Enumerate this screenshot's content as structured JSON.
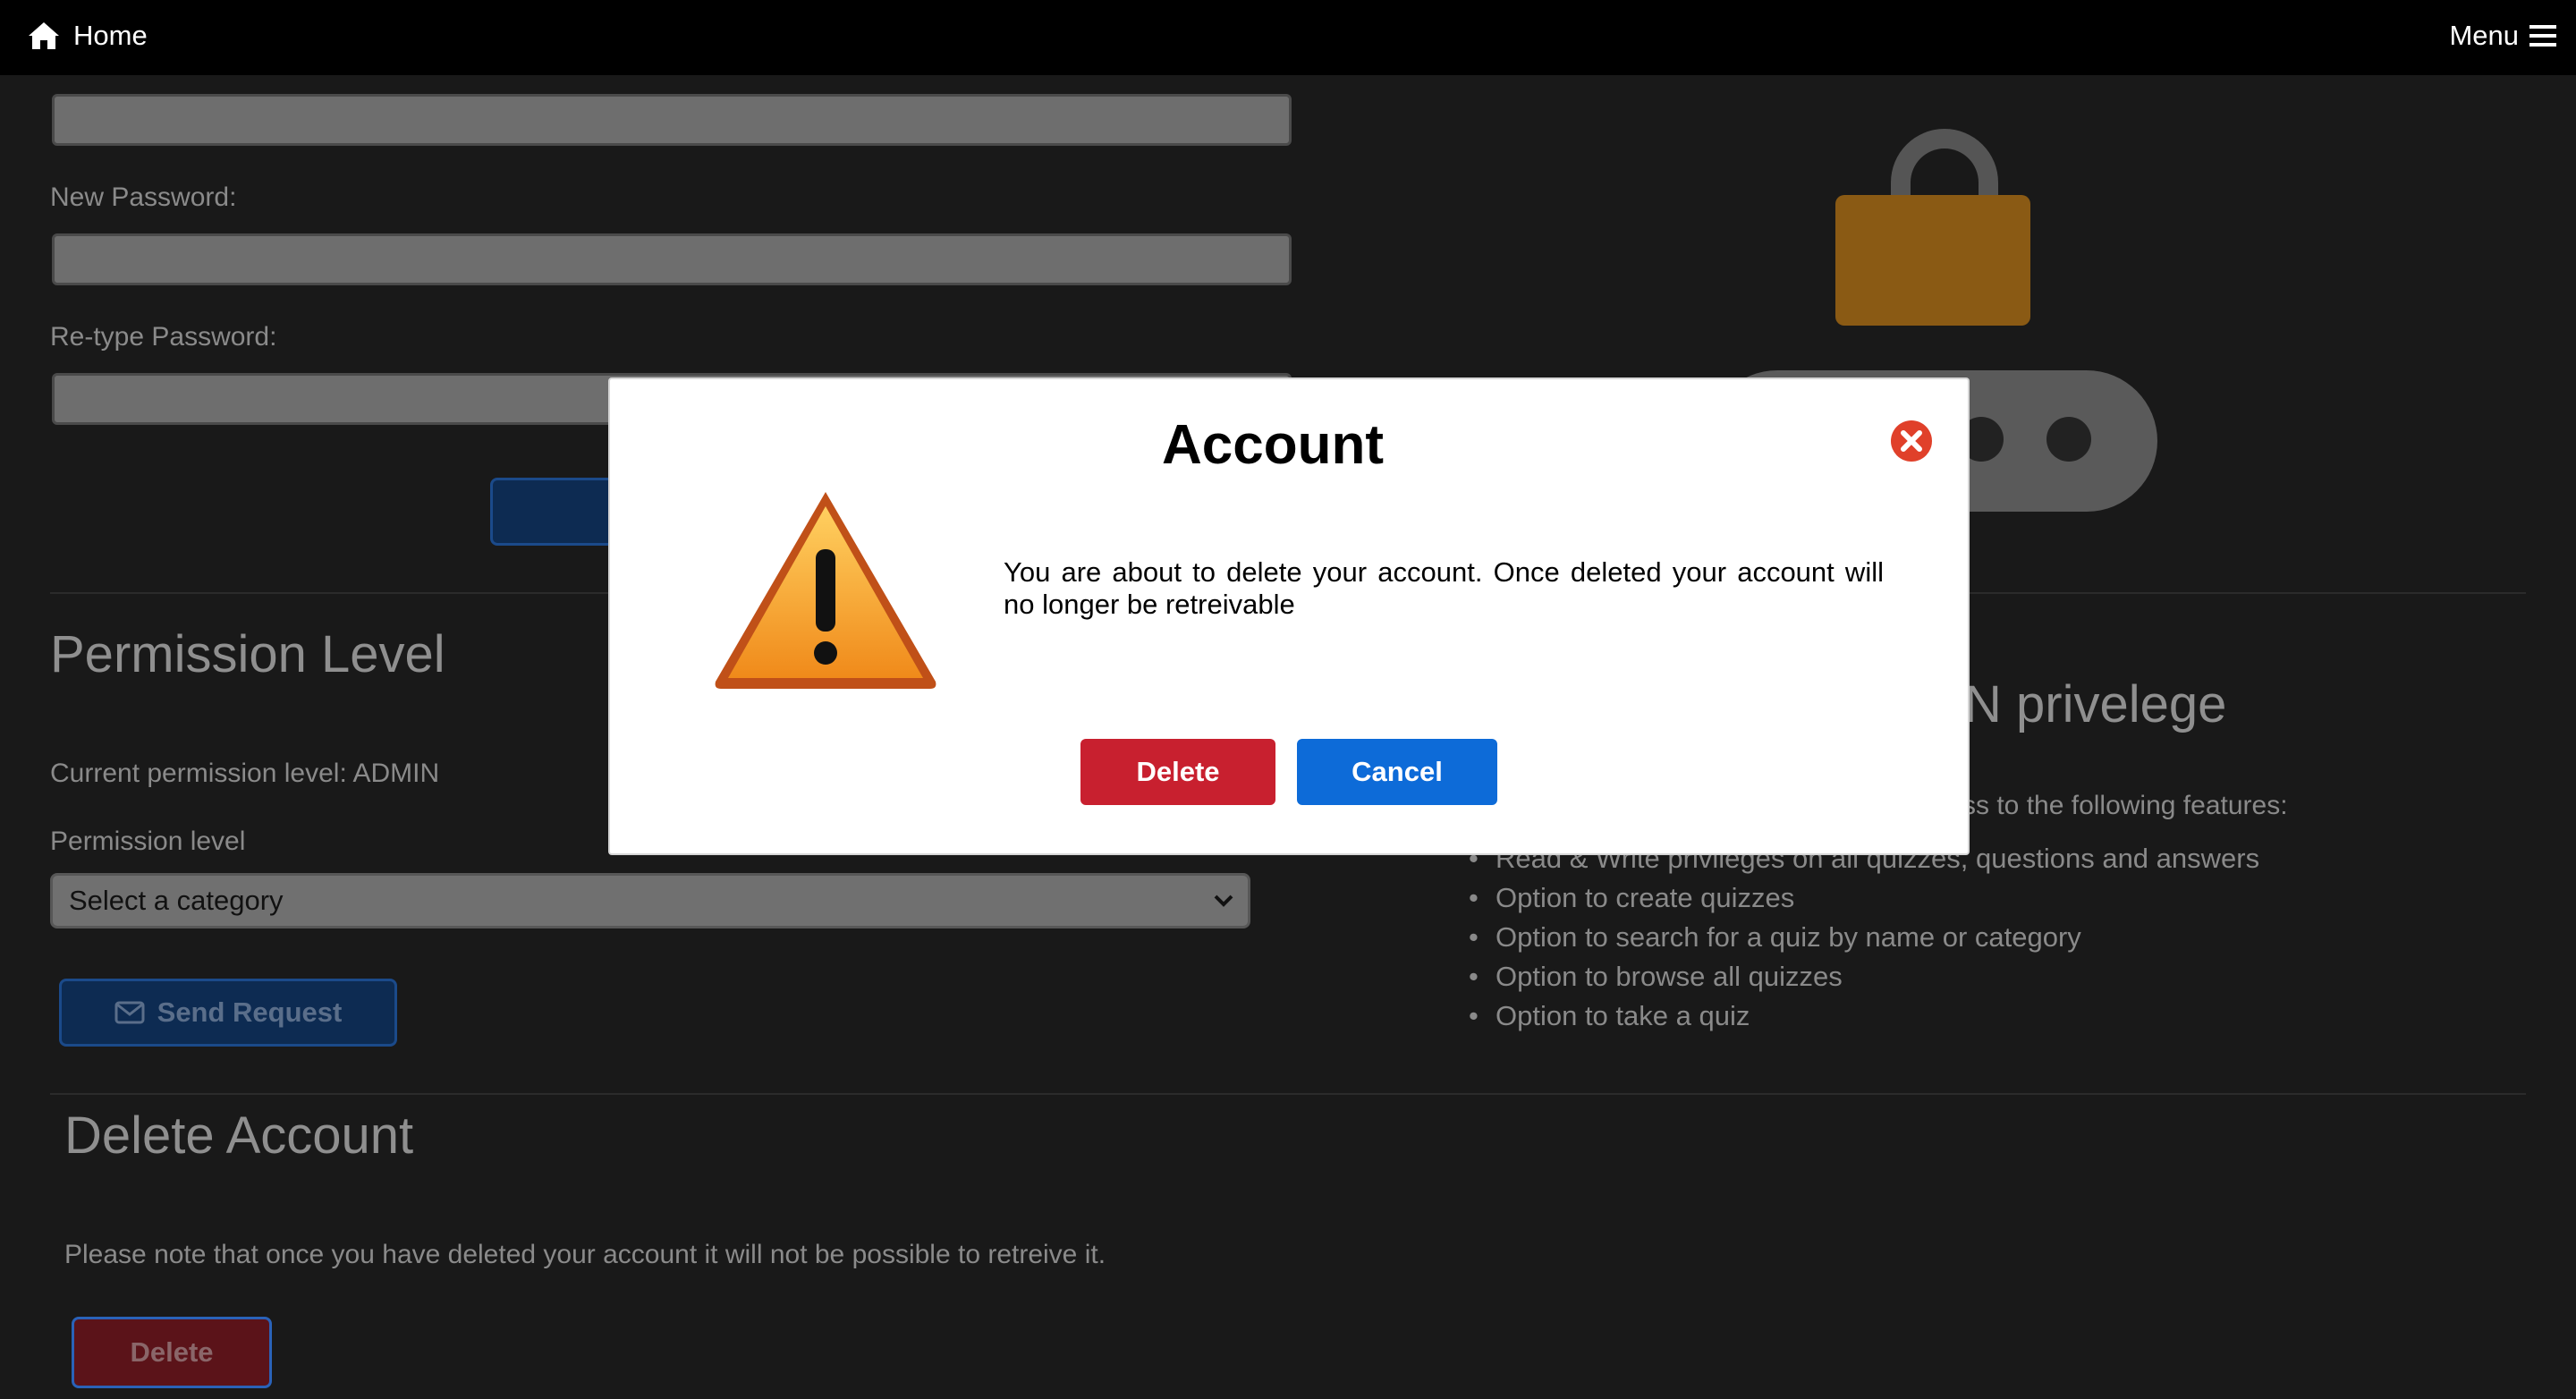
{
  "navbar": {
    "home_label": "Home",
    "home_icon": "home-icon",
    "menu_label": "Menu",
    "menu_icon": "hamburger-icon"
  },
  "password_section": {
    "new_password_label": "New Password:",
    "retype_password_label": "Re-type Password:"
  },
  "permission_section": {
    "title": "Permission Level",
    "current_level_text": "Current permission level: ADMIN",
    "level_label": "Permission level",
    "select_value": "Select a category",
    "send_button_label": "Send Request",
    "send_icon": "envelope-icon"
  },
  "privilege_section": {
    "title_fragment": "N privelege",
    "intro_fragment": "ss to the following features:",
    "features": [
      "Read & Write privileges on all quizzes, questions and answers",
      "Option to create quizzes",
      "Option to search for a quiz by name or category",
      "Option to browse all quizzes",
      "Option to take a quiz"
    ]
  },
  "delete_section": {
    "title": "Delete Account",
    "note": "Please note that once you have deleted your account it will not be possible to retreive it.",
    "delete_button_label": "Delete"
  },
  "modal": {
    "title": "Account",
    "message": "You are about to delete your account. Once deleted your account will no longer be retreivable",
    "delete_label": "Delete",
    "cancel_label": "Cancel",
    "close_icon": "close-circle-icon",
    "warning_icon": "warning-triangle-icon"
  },
  "colors": {
    "modal_delete": "#c8202f",
    "modal_cancel": "#0d6bd8",
    "close_icon": "#e0402a",
    "warning_fill": "#f2a330"
  }
}
